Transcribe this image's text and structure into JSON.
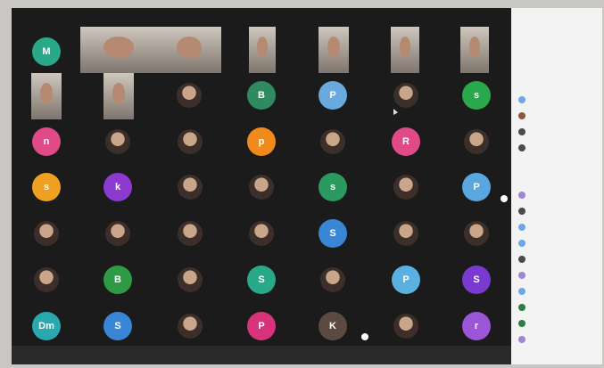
{
  "meeting": {
    "side_panel": {
      "title": "",
      "sections": [
        {
          "heading": "",
          "participants": []
        },
        {
          "heading": "",
          "participants": []
        }
      ]
    },
    "grid": {
      "video_tiles": [],
      "avatars": [
        {
          "initial": "M",
          "color": "#2aa88a"
        },
        {
          "initial": "B",
          "color": "#2f8a60"
        },
        {
          "initial": "P",
          "color": "#6aa9dd"
        },
        {
          "initial": "s",
          "color": "#2aa84c"
        },
        {
          "initial": "n",
          "color": "#e04a87"
        },
        {
          "initial": "p",
          "color": "#f08a1c"
        },
        {
          "initial": "R",
          "color": "#e04a87"
        },
        {
          "initial": "s",
          "color": "#f0a020"
        },
        {
          "initial": "k",
          "color": "#8c3ad0"
        },
        {
          "initial": "s",
          "color": "#2a9a60"
        },
        {
          "initial": "P",
          "color": "#5aa7e0"
        },
        {
          "initial": "S",
          "color": "#3a86d6"
        },
        {
          "initial": "B",
          "color": "#2f9a44"
        },
        {
          "initial": "S",
          "color": "#2aa88a"
        },
        {
          "initial": "P",
          "color": "#5ab0e0"
        },
        {
          "initial": "S",
          "color": "#7a3ad0"
        },
        {
          "initial": "Dm",
          "color": "#2aa8b0"
        },
        {
          "initial": "S",
          "color": "#3a86d6"
        },
        {
          "initial": "P",
          "color": "#d8327a"
        },
        {
          "initial": "K",
          "color": "#5a4a42"
        },
        {
          "initial": "r",
          "color": "#9a56d6"
        }
      ]
    }
  }
}
